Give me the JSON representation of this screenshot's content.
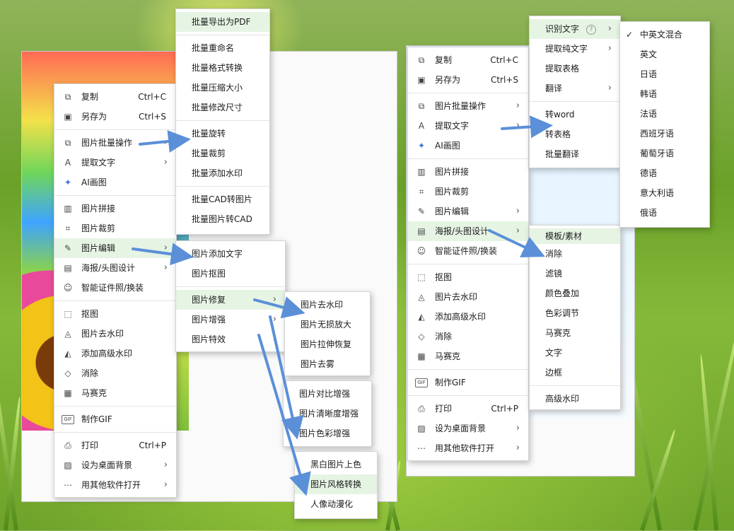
{
  "colors": {
    "arrow": "#5b8fd8",
    "highlight": "#e6f4e4"
  },
  "left_menu": {
    "items": [
      {
        "label": "复制",
        "shortcut": "Ctrl+C",
        "icon": "copy-icon",
        "glyph": "⧉"
      },
      {
        "label": "另存为",
        "shortcut": "Ctrl+S",
        "icon": "save-icon",
        "glyph": "▣"
      },
      {
        "label": "图片批量操作",
        "icon": "batch-icon",
        "glyph": "⧉",
        "arrow": "›"
      },
      {
        "label": "提取文字",
        "icon": "text-extract-icon",
        "glyph": "A",
        "arrow": "›"
      },
      {
        "label": "AI画图",
        "icon": "ai-icon",
        "glyph": "✦"
      },
      {
        "label": "图片拼接",
        "icon": "collage-icon",
        "glyph": "▥"
      },
      {
        "label": "图片裁剪",
        "icon": "crop-icon",
        "glyph": "⌗"
      },
      {
        "label": "图片编辑",
        "icon": "edit-icon",
        "glyph": "✎",
        "arrow": "›"
      },
      {
        "label": "海报/头图设计",
        "icon": "poster-icon",
        "glyph": "▤",
        "arrow": "›"
      },
      {
        "label": "智能证件照/换装",
        "icon": "id-photo-icon",
        "glyph": "☺"
      },
      {
        "label": "抠图",
        "icon": "cutout-icon",
        "glyph": "⬚"
      },
      {
        "label": "图片去水印",
        "icon": "remove-watermark-icon",
        "glyph": "◬"
      },
      {
        "label": "添加高级水印",
        "icon": "add-watermark-icon",
        "glyph": "◭"
      },
      {
        "label": "消除",
        "icon": "eraser-icon",
        "glyph": "◇"
      },
      {
        "label": "马赛克",
        "icon": "mosaic-icon",
        "glyph": "▦"
      },
      {
        "label": "制作GIF",
        "icon": "gif-icon",
        "glyph": "GIF"
      },
      {
        "label": "打印",
        "shortcut": "Ctrl+P",
        "icon": "print-icon",
        "glyph": "⎙"
      },
      {
        "label": "设为桌面背景",
        "icon": "wallpaper-icon",
        "glyph": "▨",
        "arrow": "›"
      },
      {
        "label": "用其他软件打开",
        "icon": "open-with-icon",
        "glyph": "⋯",
        "arrow": "›"
      }
    ]
  },
  "batch_menu": {
    "items": [
      "批量导出为PDF",
      "批量重命名",
      "批量格式转换",
      "批量压缩大小",
      "批量修改尺寸",
      "批量旋转",
      "批量裁剪",
      "批量添加水印",
      "批量CAD转图片",
      "批量图片转CAD"
    ]
  },
  "edit_menu": {
    "items": [
      "图片添加文字",
      "图片抠图",
      "图片修复",
      "图片增强",
      "图片特效"
    ],
    "arrow": "›"
  },
  "repair_menu": {
    "items": [
      "图片去水印",
      "图片无损放大",
      "图片拉伸恢复",
      "图片去雾"
    ]
  },
  "enhance_menu": {
    "items": [
      "图片对比增强",
      "图片清晰度增强",
      "图片色彩增强"
    ]
  },
  "effect_menu": {
    "items": [
      "黑白图片上色",
      "图片风格转换",
      "人像动漫化"
    ]
  },
  "ocr_menu": {
    "items": [
      "识别文字",
      "提取纯文字",
      "提取表格",
      "翻译",
      "转word",
      "转表格",
      "批量翻译"
    ],
    "help": "?",
    "arrow": "›"
  },
  "lang_menu": {
    "check": "✓",
    "items": [
      "中英文混合",
      "英文",
      "日语",
      "韩语",
      "法语",
      "西班牙语",
      "葡萄牙语",
      "德语",
      "意大利语",
      "俄语"
    ]
  },
  "poster_menu": {
    "items": [
      "模板/素材",
      "消除",
      "滤镜",
      "颜色叠加",
      "色彩调节",
      "马赛克",
      "文字",
      "边框",
      "高级水印"
    ]
  }
}
